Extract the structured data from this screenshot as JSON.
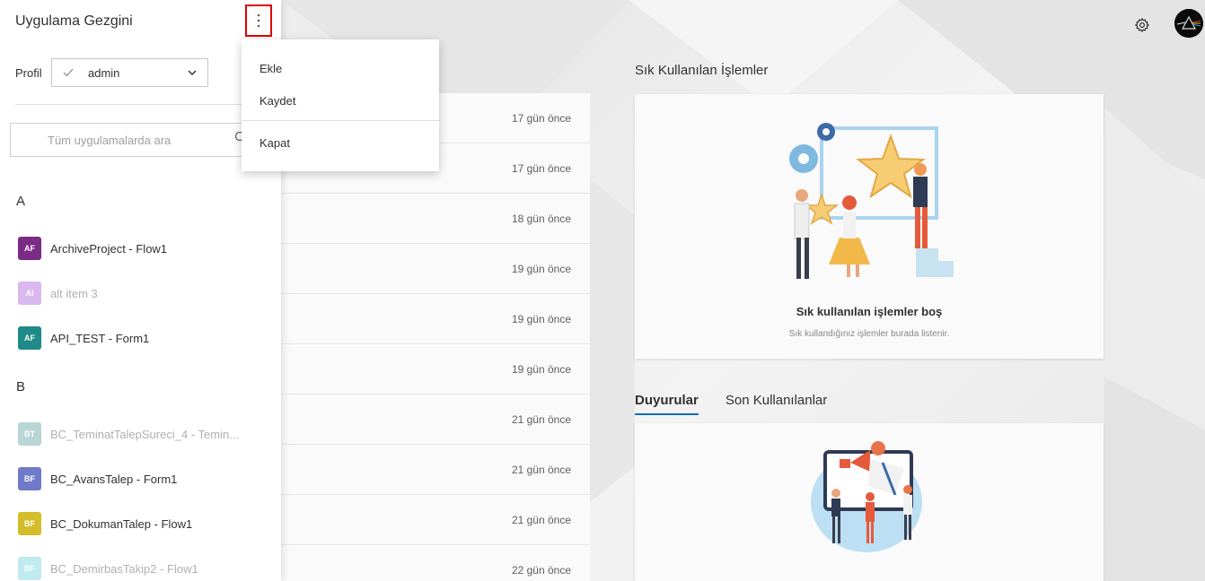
{
  "panel": {
    "title": "Uygulama Gezgini",
    "more_icon": "more-vertical-icon",
    "profile_label": "Profil",
    "profile_value": "admin",
    "search_placeholder": "Tüm uygulamalarda ara",
    "groups": [
      {
        "letter": "A",
        "items": [
          {
            "badge": "AF",
            "name": "ArchiveProject - Flow1",
            "color": "#7b2a86",
            "disabled": false
          },
          {
            "badge": "AI",
            "name": "alt item 3",
            "color": "#d9b7ef",
            "disabled": true
          },
          {
            "badge": "AF",
            "name": "API_TEST - Form1",
            "color": "#1f8a87",
            "disabled": false
          }
        ]
      },
      {
        "letter": "B",
        "items": [
          {
            "badge": "BT",
            "name": "BC_TeminatTalepSureci_4 - Temin...",
            "color": "#b9d5d6",
            "disabled": true
          },
          {
            "badge": "BF",
            "name": "BC_AvansTalep - Form1",
            "color": "#6f7bc9",
            "disabled": false
          },
          {
            "badge": "BF",
            "name": "BC_DokumanTalep - Flow1",
            "color": "#d4bd2b",
            "disabled": false
          },
          {
            "badge": "BF",
            "name": "BC_DemirbasTakip2 - Flow1",
            "color": "#bfeaf0",
            "disabled": true
          }
        ]
      }
    ]
  },
  "menu": {
    "items": [
      "Ekle",
      "Kaydet",
      "Kapat"
    ]
  },
  "recent": {
    "times": [
      "17 gün önce",
      "17 gün önce",
      "18 gün önce",
      "19 gün önce",
      "19 gün önce",
      "19 gün önce",
      "21 gün önce",
      "21 gün önce",
      "21 gün önce",
      "22 gün önce"
    ]
  },
  "frequent": {
    "title": "Sık Kullanılan İşlemler",
    "empty_title": "Sık kullanılan işlemler boş",
    "empty_subtitle": "Sık kullandığınız işlemler burada listenir."
  },
  "tabs": [
    "Duyurular",
    "Son Kullanılanlar"
  ],
  "header": {
    "settings_icon": "gear-icon",
    "avatar_icon": "user-avatar"
  },
  "colors": {
    "accent": "#0f6cbd",
    "highlight_border": "#e00000"
  }
}
